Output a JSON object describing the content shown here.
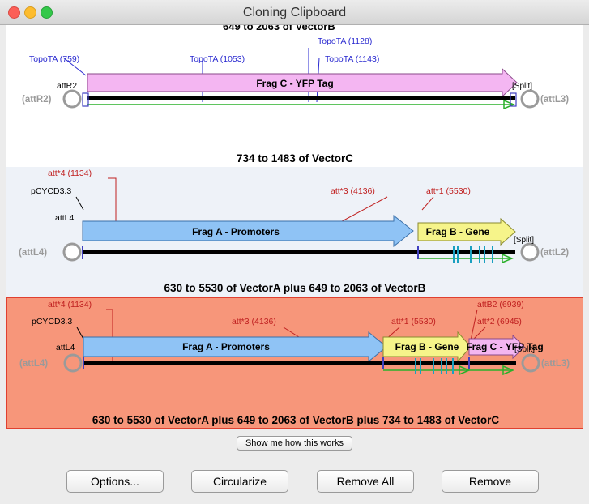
{
  "window": {
    "title": "Cloning Clipboard",
    "traffic_lights": {
      "close": "#fc5f57",
      "minimize": "#fdbc2e",
      "zoom": "#34c84a"
    }
  },
  "colors": {
    "topo_label": "#2a2ad0",
    "att_label": "#c02020",
    "end_label": "#9a9a9a",
    "frag_a": "#8fc3f5",
    "frag_b": "#f6f48a",
    "frag_c": "#f4b6f2",
    "selected_bg": "#f7967a"
  },
  "entries": [
    {
      "cut_off_label": "649 to 2063 of VectorB",
      "site_labels": [
        "TopoTA (759)",
        "TopoTA (1053)",
        "TopoTA (1128)",
        "TopoTA (1143)"
      ],
      "att_left": "attR2",
      "end_left": "(attR2)",
      "end_right": "(attL3)",
      "split": "[Split]",
      "fragments": [
        {
          "name": "Frag C - YFP Tag",
          "color": "frag_c"
        }
      ],
      "label": "734 to 1483 of VectorC"
    },
    {
      "site_labels_top": [
        "att*4 (1134)"
      ],
      "site_labels": [
        "pCYCD3.3",
        "att*3 (4136)",
        "att*1 (5530)"
      ],
      "att_left": "attL4",
      "end_left": "(attL4)",
      "end_right": "(attL2)",
      "split": "[Split]",
      "fragments": [
        {
          "name": "Frag A - Promoters",
          "color": "frag_a"
        },
        {
          "name": "Frag B - Gene",
          "color": "frag_b"
        }
      ],
      "label": "630 to 5530 of VectorA plus 649 to 2063 of VectorB"
    },
    {
      "site_labels_top": [
        "att*4 (1134)",
        "attB2 (6939)"
      ],
      "site_labels": [
        "pCYCD3.3",
        "att*3 (4136)",
        "att*1 (5530)",
        "att*2 (6945)"
      ],
      "att_left": "attL4",
      "end_left": "(attL4)",
      "end_right": "(attL3)",
      "split": "[Split]",
      "fragments": [
        {
          "name": "Frag A - Promoters",
          "color": "frag_a"
        },
        {
          "name": "Frag B - Gene",
          "color": "frag_b"
        },
        {
          "name": "Frag C - YFP Tag",
          "color": "frag_c"
        }
      ],
      "label": "630 to 5530 of VectorA plus 649 to 2063 of VectorB plus 734 to 1483 of VectorC",
      "selected": true
    }
  ],
  "buttons": {
    "show_me": "Show me how this works",
    "options": "Options...",
    "circularize": "Circularize",
    "remove_all": "Remove All",
    "remove": "Remove"
  }
}
